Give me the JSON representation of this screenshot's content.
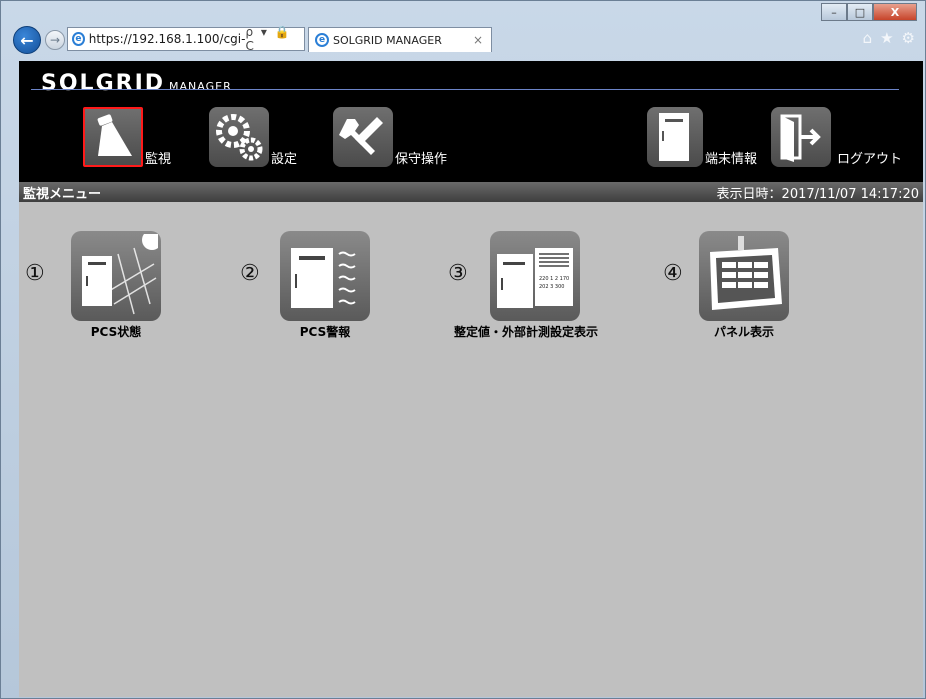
{
  "browser": {
    "address": "https://192.168.1.100/cgi-",
    "tab_title": "SOLGRID MANAGER",
    "address_tools": "ρ ▾ 🔒 C",
    "tab_close": "×",
    "window_buttons": {
      "minimize": "–",
      "maximize": "□",
      "close": "X"
    },
    "tool_icons": {
      "home": "⌂",
      "favorites": "★",
      "settings": "⚙"
    }
  },
  "header": {
    "logo_main": "SOLGRID",
    "logo_sub": "MANAGER",
    "nav": [
      {
        "label": "監視",
        "icon": "monitor-icon",
        "active": true
      },
      {
        "label": "設定",
        "icon": "gears-icon",
        "active": false
      },
      {
        "label": "保守操作",
        "icon": "tools-icon",
        "active": false
      },
      {
        "label": "端末情報",
        "icon": "terminal-icon",
        "active": false
      },
      {
        "label": "ログアウト",
        "icon": "logout-icon",
        "active": false
      }
    ]
  },
  "subbar": {
    "title": "監視メニュー",
    "datetime": "表示日時：2017/11/07 14:17:20"
  },
  "menu": [
    {
      "num": "①",
      "label": "PCS状態",
      "icon": "pcs-status-icon"
    },
    {
      "num": "②",
      "label": "PCS警報",
      "icon": "pcs-alarm-icon"
    },
    {
      "num": "③",
      "label": "整定値・外部計測設定表示",
      "icon": "setting-values-icon",
      "icon_text": "220 1 2 170\n202  3 300"
    },
    {
      "num": "④",
      "label": "パネル表示",
      "icon": "panel-display-icon"
    }
  ],
  "colors": {
    "header_bg": "#000000",
    "page_bg": "#c0c0c0",
    "active_border": "#ff1a1a"
  }
}
